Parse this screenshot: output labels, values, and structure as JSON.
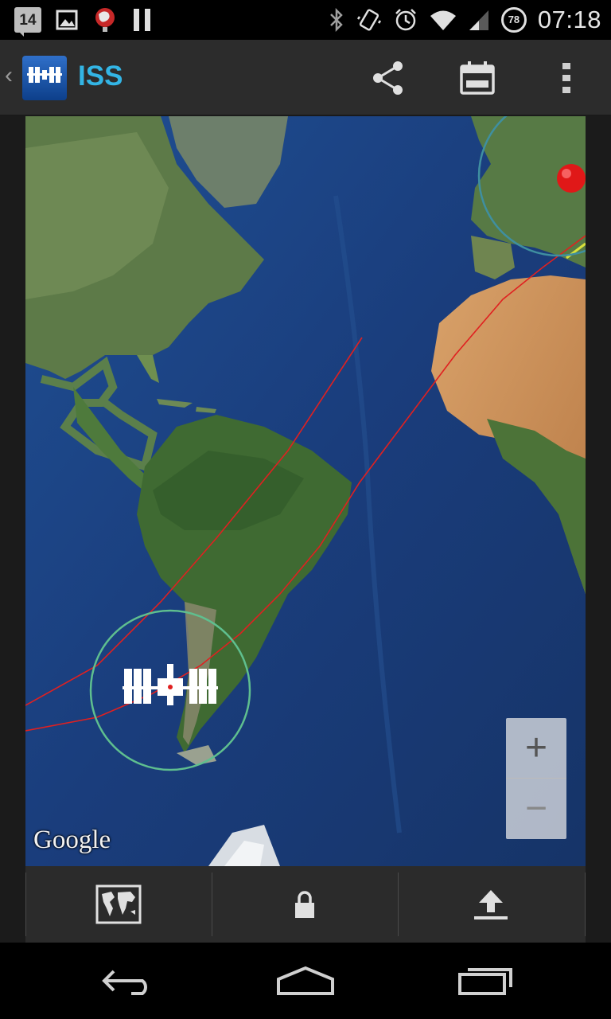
{
  "status_bar": {
    "calendar_day": "14",
    "battery_level": "78",
    "time": "07:18",
    "icons": [
      "calendar-notification-icon",
      "image-notification-icon",
      "globe-notification-icon",
      "pause-notification-icon",
      "bluetooth-icon",
      "vibrate-icon",
      "alarm-icon",
      "wifi-icon",
      "signal-icon",
      "battery-icon"
    ]
  },
  "action_bar": {
    "title": "ISS",
    "accent_color": "#33b5e5",
    "actions": [
      "share-icon",
      "calendar-icon",
      "overflow-menu-icon"
    ]
  },
  "map": {
    "attribution": "Google",
    "zoom_in_label": "+",
    "zoom_out_label": "−",
    "orbit_color": "#e02020",
    "station_marker": "iss-station-icon",
    "observer_marker": "red-location-pin",
    "visibility_circle_color": "#5fbf8f"
  },
  "toolbar": {
    "buttons": [
      "world-map-icon",
      "lock-icon",
      "upload-icon"
    ]
  },
  "nav_bar": {
    "buttons": [
      "back-icon",
      "home-icon",
      "recent-apps-icon"
    ]
  }
}
